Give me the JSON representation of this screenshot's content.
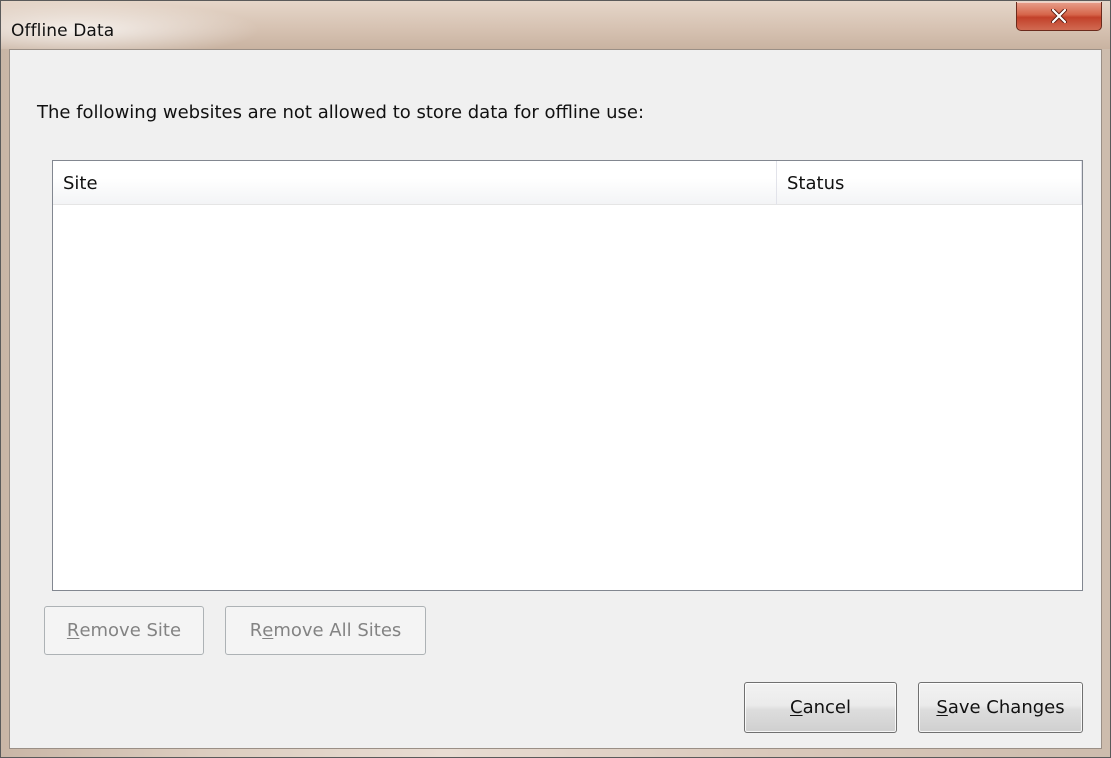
{
  "window": {
    "title": "Offline Data"
  },
  "dialog": {
    "description": "The following websites are not allowed to store data for offline use:"
  },
  "sites_table": {
    "columns": [
      "Site",
      "Status"
    ],
    "rows": []
  },
  "buttons": {
    "remove_site": {
      "pre": "",
      "accel": "R",
      "post": "emove Site"
    },
    "remove_all_sites": {
      "pre": "R",
      "accel": "e",
      "post": "move All Sites"
    },
    "cancel": {
      "pre": "",
      "accel": "C",
      "post": "ancel"
    },
    "save_changes": {
      "pre": "",
      "accel": "S",
      "post": "ave Changes"
    }
  },
  "icons": {
    "close": "close-icon"
  },
  "colors": {
    "close_button": "#c2412a",
    "dialog_background": "#f0f0f0",
    "disabled_text": "#838383"
  }
}
